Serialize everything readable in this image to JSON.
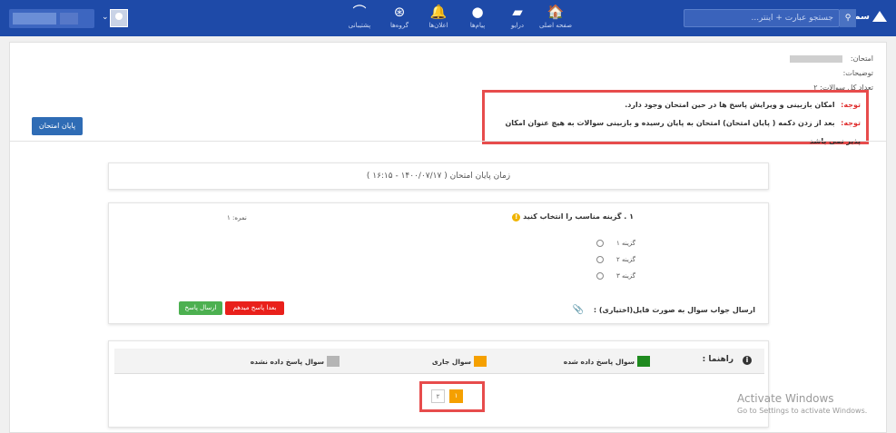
{
  "navbar": {
    "logo": "سماسامانه",
    "search_placeholder": "جستجو عبارت + اینتر...",
    "items": [
      {
        "label": "صفحه اصلی",
        "icon": "home-icon",
        "glyph": "🏠"
      },
      {
        "label": "درایو",
        "icon": "drive-icon",
        "glyph": "▰"
      },
      {
        "label": "پیام‌ها",
        "icon": "messages-icon",
        "glyph": "●"
      },
      {
        "label": "اعلان‌ها",
        "icon": "bell-icon",
        "glyph": "🔔"
      },
      {
        "label": "گروه‌ها",
        "icon": "groups-icon",
        "glyph": "⊛"
      },
      {
        "label": "پشتیبانی",
        "icon": "support-icon",
        "glyph": "⌒"
      }
    ]
  },
  "exam": {
    "name_label": "امتحان:",
    "desc_label": "توضیحات:",
    "count_label": "تعداد کل سوالات:",
    "count_value": "۲"
  },
  "notes": [
    {
      "label": "توجه:",
      "text": "امکان بازبینی و ویرایش پاسخ ها در حین امتحان وجود دارد."
    },
    {
      "label": "توجه:",
      "text": "بعد از زدن دکمه ( پایان امتحان) امتحان به پایان رسیده و بازبینی سوالات به هیچ عنوان امکان پذیر نمی باشد"
    }
  ],
  "end_exam_button": "پایان امتحان",
  "end_time": "زمان پایان امتحان ( ۱۴۰۰/۰۷/۱۷ - ۱۶:۱۵ )",
  "question": {
    "title": "۱ . گزینه مناسب را انتخاب کنید",
    "score_label": "نمره:",
    "score_value": "۱",
    "options": [
      "گزینه ۱",
      "گزینه ۲",
      "گزینه ۳"
    ],
    "upload_label": "ارسال جواب سوال به صورت فایل(اختیاری) :",
    "later_button": "بعدا پاسخ میدهم",
    "send_button": "ارسال پاسخ"
  },
  "guide": {
    "title": "راهنما :",
    "legend": [
      {
        "label": "سوال پاسخ داده شده",
        "color": "#1f8a1f"
      },
      {
        "label": "سوال جاری",
        "color": "#f5a000"
      },
      {
        "label": "سوال پاسخ داده نشده",
        "color": "#b5b5b5"
      }
    ],
    "pages": [
      "۲",
      "۱"
    ]
  },
  "watermark": {
    "line1": "Activate Windows",
    "line2": "Go to Settings to activate Windows."
  }
}
